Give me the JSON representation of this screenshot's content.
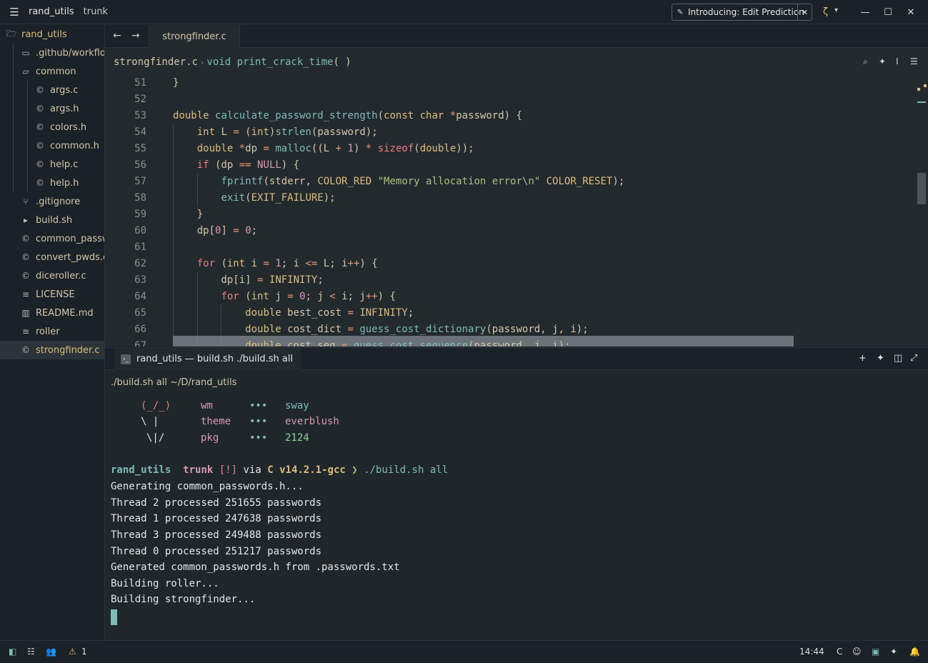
{
  "titlebar": {
    "project": "rand_utils",
    "branch": "trunk",
    "banner_text": "Introducing: Edit Prediction"
  },
  "sidebar": {
    "root": "rand_utils",
    "items": [
      {
        "label": ".github/workflows",
        "icon": "folder-icon"
      },
      {
        "label": "common",
        "icon": "folder-open-icon"
      },
      {
        "label": "args.c",
        "icon": "c-file-icon"
      },
      {
        "label": "args.h",
        "icon": "c-file-icon"
      },
      {
        "label": "colors.h",
        "icon": "c-file-icon"
      },
      {
        "label": "common.h",
        "icon": "c-file-icon"
      },
      {
        "label": "help.c",
        "icon": "c-file-icon"
      },
      {
        "label": "help.h",
        "icon": "c-file-icon"
      },
      {
        "label": ".gitignore",
        "icon": "git-icon"
      },
      {
        "label": "build.sh",
        "icon": "terminal-file-icon"
      },
      {
        "label": "common_passwords.h",
        "icon": "c-file-icon"
      },
      {
        "label": "convert_pwds.c",
        "icon": "c-file-icon"
      },
      {
        "label": "diceroller.c",
        "icon": "c-file-icon"
      },
      {
        "label": "LICENSE",
        "icon": "text-file-icon"
      },
      {
        "label": "README.md",
        "icon": "book-icon"
      },
      {
        "label": "roller",
        "icon": "text-file-icon"
      },
      {
        "label": "strongfinder.c",
        "icon": "c-file-icon"
      }
    ]
  },
  "editor": {
    "tab": "strongfinder.c",
    "breadcrumb_file": "strongfinder.c",
    "breadcrumb_kw": "void",
    "breadcrumb_fn": "print_crack_time",
    "breadcrumb_args": "( )",
    "line_numbers": [
      "51",
      "52",
      "53",
      "54",
      "55",
      "56",
      "57",
      "58",
      "59",
      "60",
      "61",
      "62",
      "63",
      "64",
      "65",
      "66",
      "67"
    ]
  },
  "terminal": {
    "tab_title": "rand_utils — build.sh ./build.sh all",
    "header": "./build.sh all ~/D/rand_utils",
    "fetch": [
      {
        "art": "(_/_)",
        "key": "wm",
        "dots": "•••",
        "val": "sway"
      },
      {
        "art": "\\ |",
        "key": "theme",
        "dots": "•••",
        "val": "everblush"
      },
      {
        "art": "\\|/",
        "key": "pkg",
        "dots": "•••",
        "val": "2124"
      }
    ],
    "prompt": {
      "dir": "rand_utils",
      "branch_sym": "",
      "branch": "trunk",
      "status": "[!]",
      "via": "via",
      "lang": "C v14.2.1-gcc",
      "arrow": "❯",
      "cmd": "./build.sh all"
    },
    "output": [
      "Generating common_passwords.h...",
      "Thread 2 processed 251655 passwords",
      "Thread 1 processed 247638 passwords",
      "Thread 3 processed 249488 passwords",
      "Thread 0 processed 251217 passwords",
      "Generated common_passwords.h from .passwords.txt",
      "Building roller...",
      "Building strongfinder..."
    ]
  },
  "statusbar": {
    "warnings": "1",
    "time": "14:44",
    "language": "C"
  }
}
